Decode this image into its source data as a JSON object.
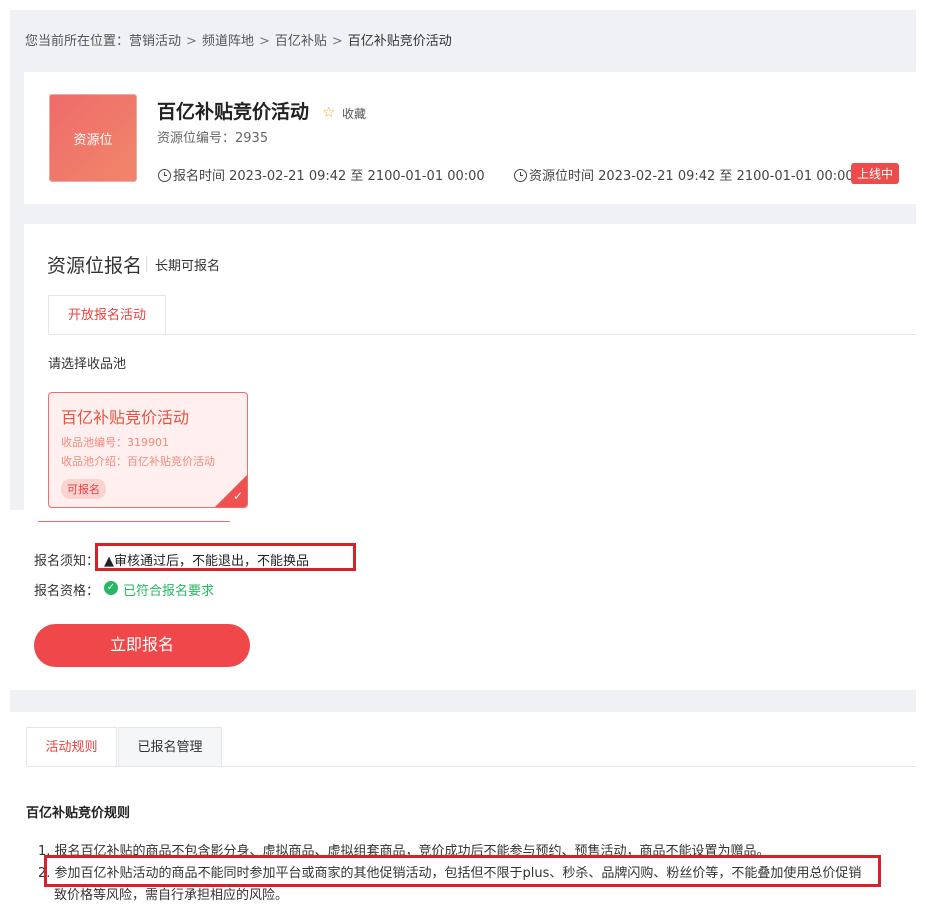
{
  "breadcrumb": {
    "prefix": "您当前所在位置：",
    "items": [
      "营销活动",
      "频道阵地",
      "百亿补贴",
      "百亿补贴竞价活动"
    ],
    "separator": ">"
  },
  "header": {
    "thumb_label": "资源位",
    "title": "百亿补贴竞价活动",
    "favorite_label": "收藏",
    "resource_no": "资源位编号：2935",
    "signup_time": "报名时间 2023-02-21 09:42 至 2100-01-01 00:00",
    "resource_time": "资源位时间 2023-02-21 09:42 至 2100-01-01 00:00",
    "status": "上线中"
  },
  "signup": {
    "title": "资源位报名",
    "subtitle": "长期可报名",
    "tab_label": "开放报名活动",
    "choose_label": "请选择收品池",
    "pool": {
      "title": "百亿补贴竞价活动",
      "no": "收品池编号：319901",
      "desc": "收品池介绍：百亿补贴竞价活动",
      "tag": "可报名"
    },
    "notice_label": "报名须知：",
    "notice_text": "审核通过后，不能退出，不能换品",
    "qualification_label": "报名资格：",
    "qualification_text": "已符合报名要求",
    "button_label": "立即报名"
  },
  "bottom_tabs": [
    "活动规则",
    "已报名管理"
  ],
  "rules": {
    "title": "百亿补贴竞价规则",
    "items": [
      "1. 报名百亿补贴的商品不包含影分身、虚拟商品、虚拟组套商品，竞价成功后不能参与预约、预售活动，商品不能设置为赠品。",
      "2. 参加百亿补贴活动的商品不能同时参加平台或商家的其他促销活动，包括但不限于plus、秒杀、品牌闪购、粉丝价等，不能叠加使用总价促销",
      "致价格等风险，需自行承担相应的风险。"
    ]
  },
  "colors": {
    "accent": "#e8423f",
    "button": "#f0484a",
    "success": "#28b862",
    "highlight_box": "#d6202a",
    "gray_bg": "#eff1f5"
  },
  "icons": [
    "star-icon",
    "clock-icon",
    "warning-icon",
    "check-circle-icon",
    "check-icon"
  ]
}
